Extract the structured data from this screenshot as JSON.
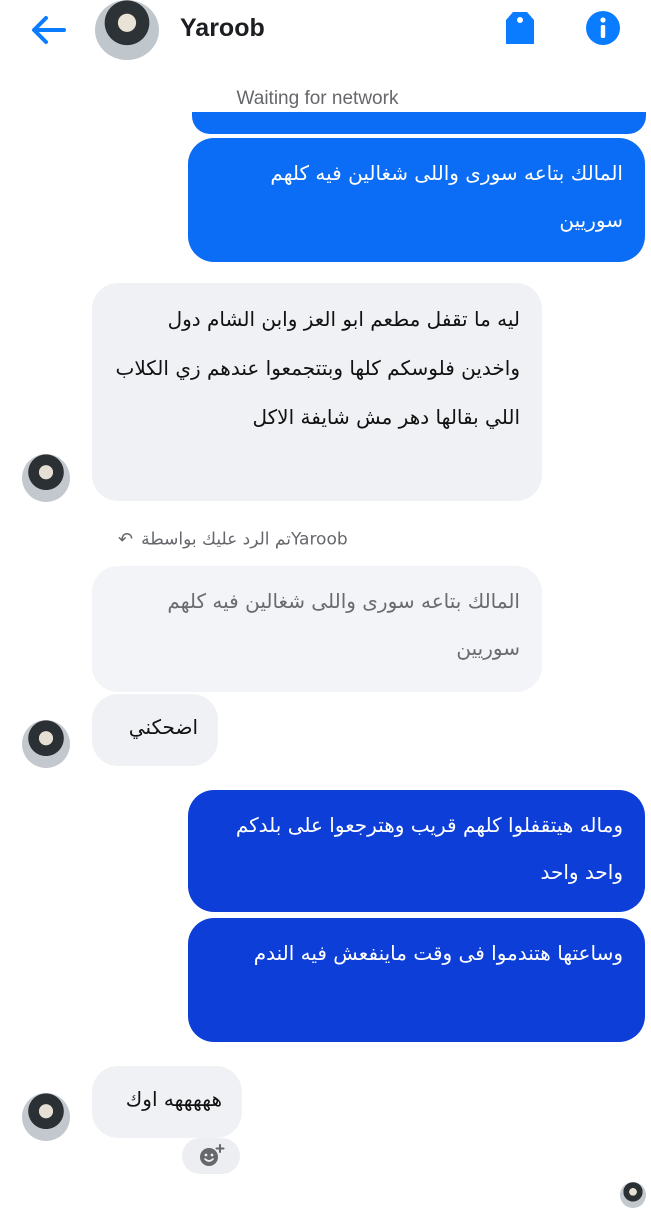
{
  "header": {
    "contact_name": "Yaroob",
    "back_icon": "arrow-left-icon",
    "tag_icon": "tag-icon",
    "info_icon": "info-icon",
    "accent": "#0a7cff"
  },
  "status": {
    "text": "Waiting for network"
  },
  "messages": [
    {
      "direction": "outgoing",
      "text": "المالك بتاعه سورى واللى شغالين فيه كلهم سوريين"
    },
    {
      "direction": "incoming",
      "text": "ليه ما تقفل مطعم ابو العز وابن الشام دول واخدين فلوسكم كلها وبتتجمعوا عندهم زي الكلاب اللي بقالها دهر مش شايفة الاكل"
    },
    {
      "direction": "incoming",
      "quoted_text": "المالك بتاعه سورى واللى شغالين فيه كلهم سوريين",
      "text": "اضحكني"
    },
    {
      "direction": "outgoing",
      "text": "وماله هيتقفلوا كلهم قريب وهترجعوا على بلدكم واحد واحد"
    },
    {
      "direction": "outgoing",
      "text": "وساعتها هتندموا فى وقت ماينفعش فيه الندم"
    },
    {
      "direction": "incoming",
      "text": "هههههه اوك"
    }
  ],
  "reply_note": {
    "name": "Yaroob",
    "text": "تم الرد عليك بواسطة"
  },
  "colors": {
    "outgoing_light": "#0b6cf5",
    "outgoing_dark": "#0d3fd8",
    "incoming": "#f0f1f4"
  }
}
